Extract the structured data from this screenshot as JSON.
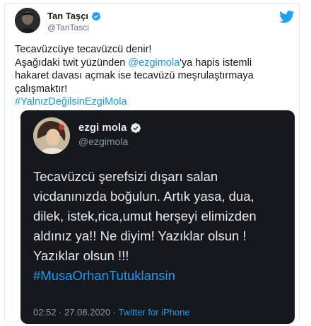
{
  "author": {
    "name": "Tan Taşçı",
    "handle": "@TanTasci"
  },
  "tweet": {
    "line1": "Tecavüzcüye tecavüzcü denir!",
    "line2_pre": "Aşağıdaki twit yüzünden ",
    "line2_mention": "@ezgimola",
    "line2_post": "'ya  hapis istemli",
    "line3": "hakaret davası açmak ise tecavüzü meşrulaştırmaya",
    "line4": "çalışmaktır!",
    "hashtag": "#YalnızDeğilsinEzgiMola"
  },
  "embedded": {
    "name": "ezgi mola",
    "handle": "@ezgimola",
    "lines": [
      "Tecavüzcü şerefsizi dışarı salan",
      "vicdanınızda boğulun. Artık yasa, dua,",
      "dilek, istek,rica,umut herşeyi elimizden",
      "aldınız ya!! Ne diyim! Yazıklar olsun !",
      "Yazıklar olsun !!!"
    ],
    "hashtag": "#MusaOrhanTutuklansin",
    "timestamp": "02:52 · 27.08.2020 · ",
    "client": "Twitter for iPhone"
  },
  "icons": {
    "verified": "verified-badge-icon",
    "brand": "twitter-bird-icon"
  },
  "colors": {
    "link": "#1b95e0",
    "card_bg": "#15181c",
    "verified": "#1da1f2"
  }
}
